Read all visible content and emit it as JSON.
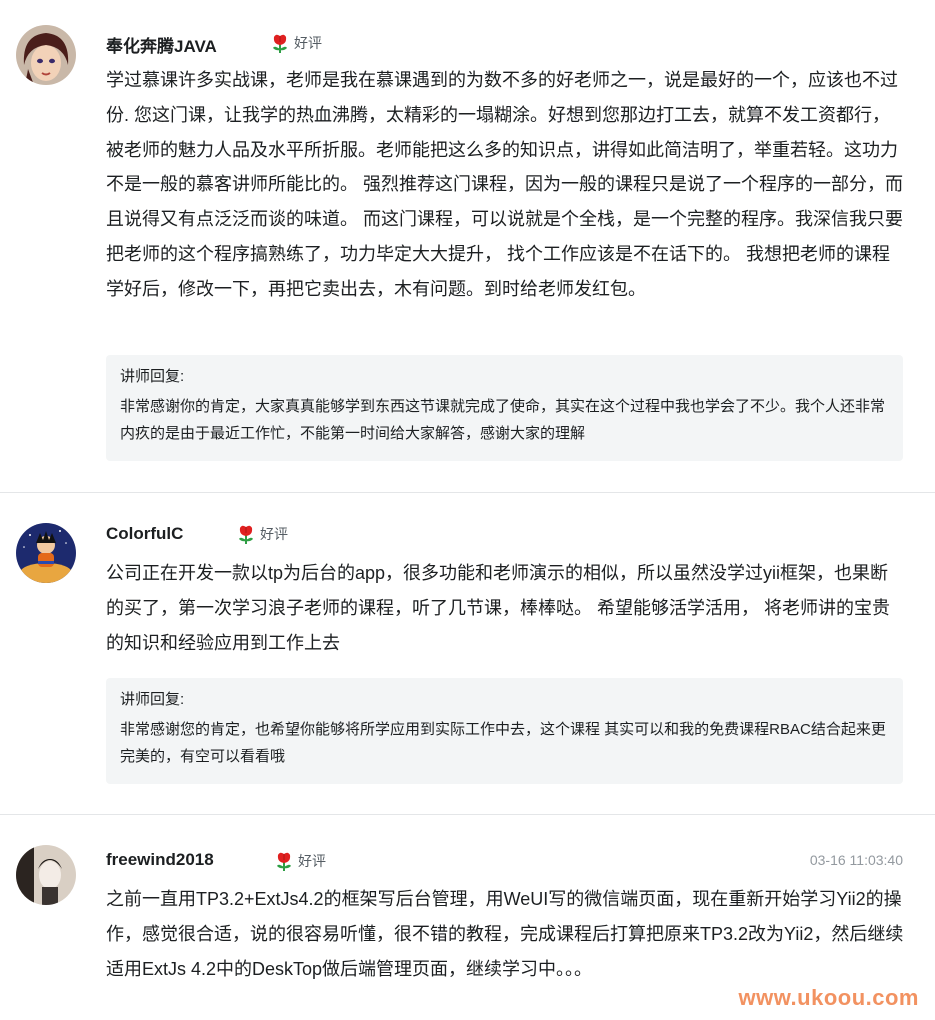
{
  "reviews": [
    {
      "username": "奉化奔腾JAVA",
      "rating_label": "好评",
      "timestamp": "",
      "content": "学过慕课许多实战课，老师是我在慕课遇到的为数不多的好老师之一，说是最好的一个，应该也不过份. 您这门课，让我学的热血沸腾，太精彩的一塌糊涂。好想到您那边打工去，就算不发工资都行，被老师的魅力人品及水平所折服。老师能把这么多的知识点，讲得如此简洁明了，举重若轻。这功力不是一般的慕客讲师所能比的。 强烈推荐这门课程，因为一般的课程只是说了一个程序的一部分，而且说得又有点泛泛而谈的味道。 而这门课程，可以说就是个全栈，是一个完整的程序。我深信我只要把老师的这个程序搞熟练了，功力毕定大大提升， 找个工作应该是不在话下的。 我想把老师的课程学好后，修改一下，再把它卖出去，木有问题。到时给老师发红包。",
      "reply_label": "讲师回复:",
      "reply_text": "非常感谢你的肯定，大家真真能够学到东西这节课就完成了使命，其实在这个过程中我也学会了不少。我个人还非常内疚的是由于最近工作忙，不能第一时间给大家解答，感谢大家的理解"
    },
    {
      "username": "ColorfulC",
      "rating_label": "好评",
      "timestamp": "",
      "content": "公司正在开发一款以tp为后台的app，很多功能和老师演示的相似，所以虽然没学过yii框架，也果断的买了，第一次学习浪子老师的课程，听了几节课，棒棒哒。 希望能够活学活用， 将老师讲的宝贵的知识和经验应用到工作上去",
      "reply_label": "讲师回复:",
      "reply_text": "非常感谢您的肯定，也希望你能够将所学应用到实际工作中去，这个课程 其实可以和我的免费课程RBAC结合起来更完美的，有空可以看看哦"
    },
    {
      "username": "freewind2018",
      "rating_label": "好评",
      "timestamp": "03-16 11:03:40",
      "content": "之前一直用TP3.2+ExtJs4.2的框架写后台管理，用WeUI写的微信端页面，现在重新开始学习Yii2的操作，感觉很合适，说的很容易听懂，很不错的教程，完成课程后打算把原来TP3.2改为Yii2，然后继续适用ExtJs 4.2中的DeskTop做后端管理页面，继续学习中。。。",
      "reply_label": "",
      "reply_text": ""
    }
  ],
  "watermark": "www.ukoou.com",
  "colors": {
    "flower": "#e02020",
    "leaf": "#2e9e44",
    "reply_bg": "#f3f5f6",
    "watermark": "#f29261"
  }
}
